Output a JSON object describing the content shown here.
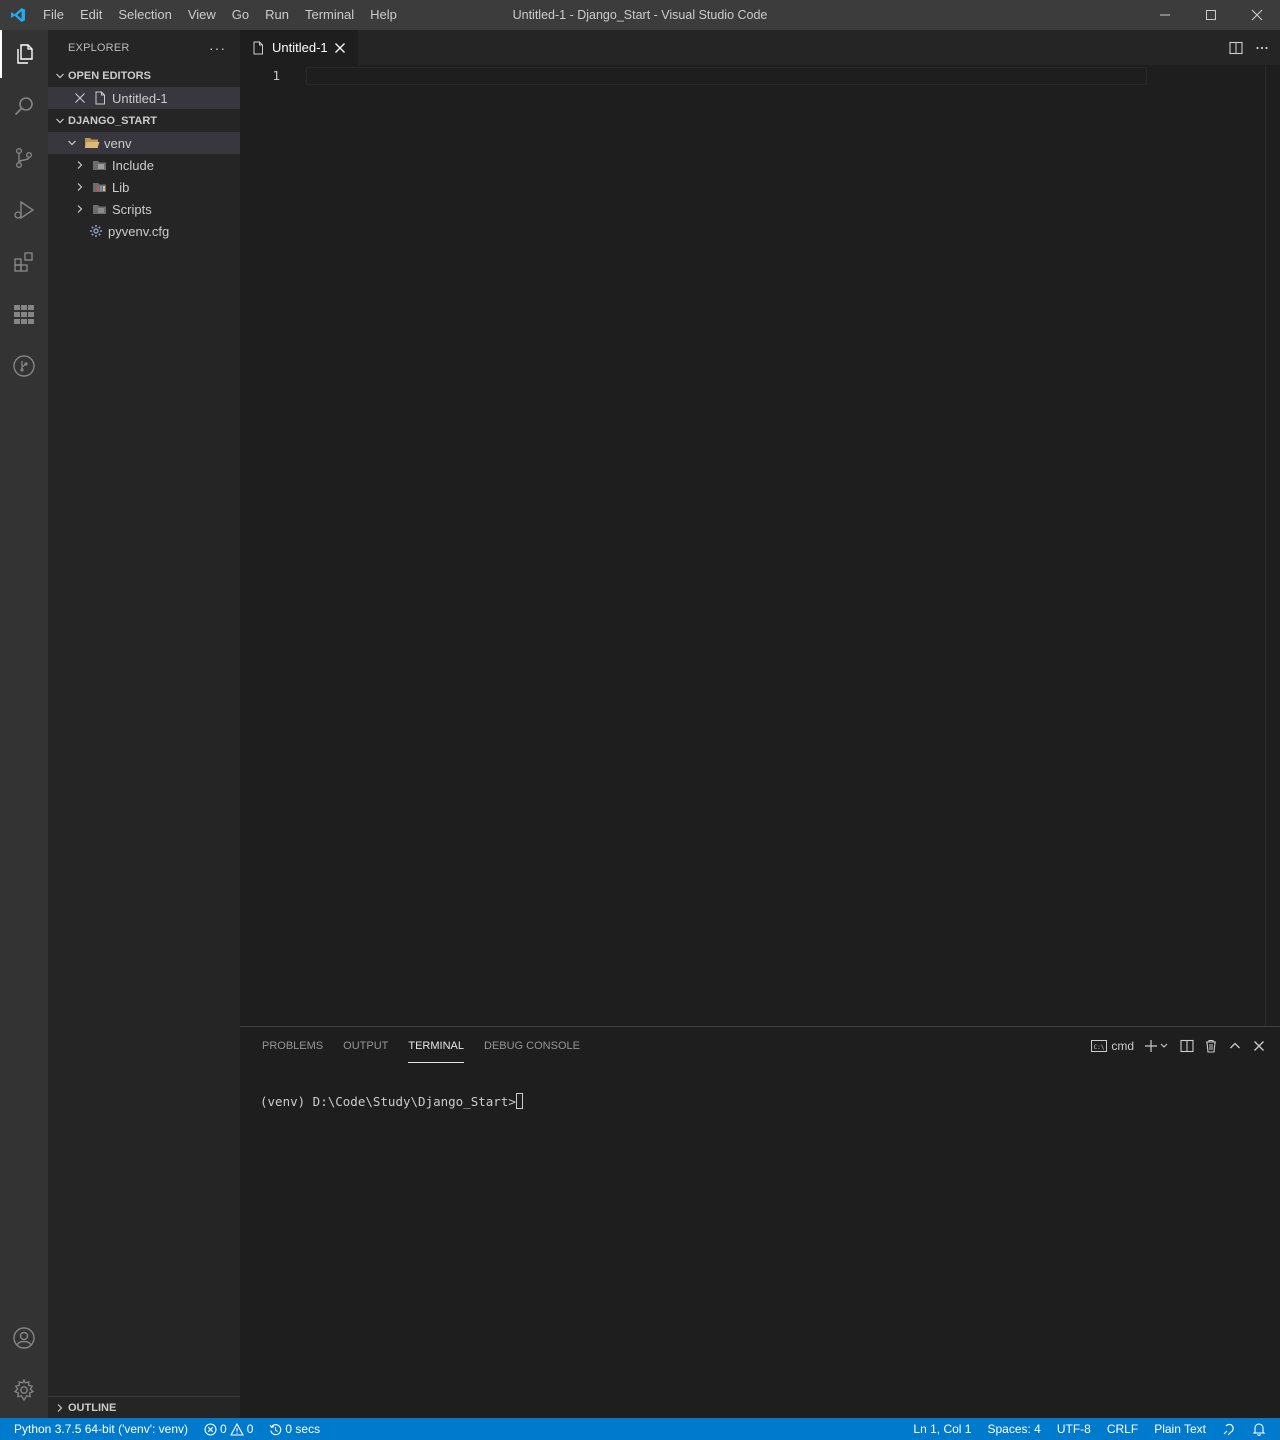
{
  "window": {
    "title": "Untitled-1 - Django_Start - Visual Studio Code",
    "menu": [
      "File",
      "Edit",
      "Selection",
      "View",
      "Go",
      "Run",
      "Terminal",
      "Help"
    ]
  },
  "sidebar": {
    "header": "EXPLORER",
    "more": "···",
    "open_editors": {
      "title": "OPEN EDITORS",
      "items": [
        {
          "label": "Untitled-1"
        }
      ]
    },
    "project": {
      "title": "DJANGO_START",
      "tree": [
        {
          "label": "venv"
        },
        {
          "label": "Include"
        },
        {
          "label": "Lib"
        },
        {
          "label": "Scripts"
        },
        {
          "label": "pyvenv.cfg"
        }
      ]
    },
    "outline_title": "OUTLINE"
  },
  "editor": {
    "tab_label": "Untitled-1",
    "line_number": "1"
  },
  "panel": {
    "tabs": [
      "PROBLEMS",
      "OUTPUT",
      "TERMINAL",
      "DEBUG CONSOLE"
    ],
    "active_tab": "TERMINAL",
    "shell": "cmd",
    "terminal_prompt": "(venv) D:\\Code\\Study\\Django_Start>"
  },
  "statusbar": {
    "interpreter": "Python 3.7.5 64-bit ('venv': venv)",
    "errors": "0",
    "warnings": "0",
    "timer": "0 secs",
    "position": "Ln 1, Col 1",
    "spaces": "Spaces: 4",
    "encoding": "UTF-8",
    "eol": "CRLF",
    "language": "Plain Text"
  },
  "colors": {
    "accent": "#007acc",
    "titlebar": "#3c3c3c",
    "activitybar": "#333333",
    "sidebar": "#252526",
    "editor": "#1e1e1e"
  }
}
